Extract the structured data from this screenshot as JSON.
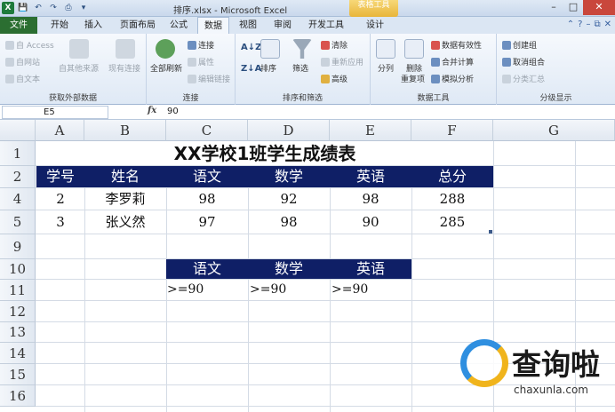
{
  "window": {
    "title": "排序.xlsx - Microsoft Excel",
    "context_tab": "表格工具"
  },
  "ribbon_tabs": [
    "文件",
    "开始",
    "插入",
    "页面布局",
    "公式",
    "数据",
    "视图",
    "审阅",
    "开发工具",
    "设计"
  ],
  "ribbon": {
    "external_data": {
      "items": [
        "自 Access",
        "自网站",
        "自文本"
      ],
      "other_sources": "自其他来源",
      "existing": "现有连接",
      "title": "获取外部数据"
    },
    "connections": {
      "refresh_all": "全部刷新",
      "items": [
        "连接",
        "属性",
        "编辑链接"
      ],
      "title": "连接"
    },
    "sort_filter": {
      "sort": "排序",
      "filter": "筛选",
      "items": [
        "清除",
        "重新应用",
        "高级"
      ],
      "title": "排序和筛选"
    },
    "data_tools": {
      "split": "分列",
      "dedupe": "删除",
      "dedupe2": "重复项",
      "items": [
        "数据有效性",
        "合并计算",
        "模拟分析"
      ],
      "title": "数据工具"
    },
    "outline": {
      "items": [
        "创建组",
        "取消组合",
        "分类汇总"
      ],
      "title": "分级显示"
    }
  },
  "formula_bar": {
    "name_box": "E5",
    "fx": "fx",
    "value": "90"
  },
  "columns": [
    "A",
    "B",
    "C",
    "D",
    "E",
    "F",
    "G"
  ],
  "rows": [
    "1",
    "2",
    "4",
    "5",
    "9",
    "10",
    "11",
    "12",
    "13",
    "14",
    "15",
    "16"
  ],
  "sheet": {
    "title": "XX学校1班学生成绩表",
    "headers": [
      "学号",
      "姓名",
      "语文",
      "数学",
      "英语",
      "总分"
    ],
    "records": [
      [
        "2",
        "李罗莉",
        "98",
        "92",
        "98",
        "288"
      ],
      [
        "3",
        "张义然",
        "97",
        "98",
        "90",
        "285"
      ]
    ],
    "criteria_headers": [
      "语文",
      "数学",
      "英语"
    ],
    "criteria_values": [
      ">=90",
      ">=90",
      ">=90"
    ]
  },
  "watermark": {
    "text": "查询啦",
    "url": "chaxunla.com"
  }
}
